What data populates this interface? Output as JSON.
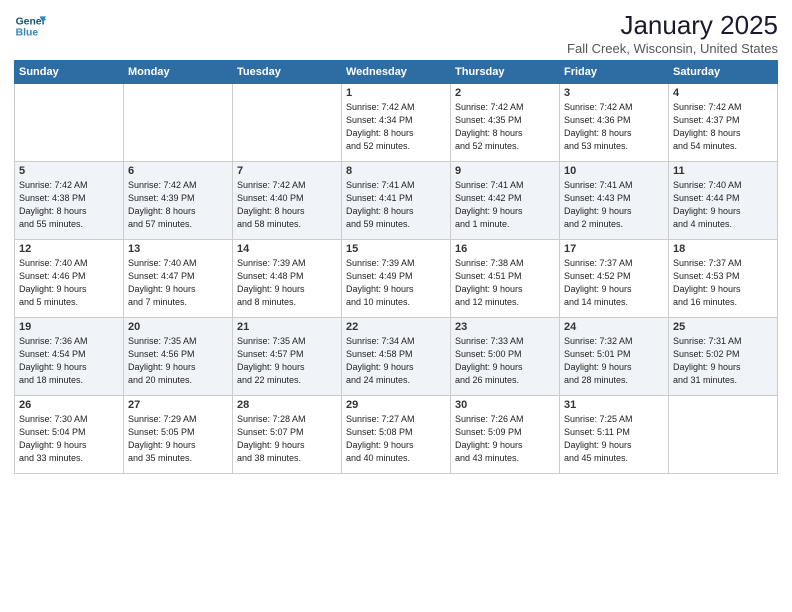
{
  "logo": {
    "line1": "General",
    "line2": "Blue"
  },
  "title": "January 2025",
  "subtitle": "Fall Creek, Wisconsin, United States",
  "days_header": [
    "Sunday",
    "Monday",
    "Tuesday",
    "Wednesday",
    "Thursday",
    "Friday",
    "Saturday"
  ],
  "weeks": [
    [
      {
        "num": "",
        "info": ""
      },
      {
        "num": "",
        "info": ""
      },
      {
        "num": "",
        "info": ""
      },
      {
        "num": "1",
        "info": "Sunrise: 7:42 AM\nSunset: 4:34 PM\nDaylight: 8 hours\nand 52 minutes."
      },
      {
        "num": "2",
        "info": "Sunrise: 7:42 AM\nSunset: 4:35 PM\nDaylight: 8 hours\nand 52 minutes."
      },
      {
        "num": "3",
        "info": "Sunrise: 7:42 AM\nSunset: 4:36 PM\nDaylight: 8 hours\nand 53 minutes."
      },
      {
        "num": "4",
        "info": "Sunrise: 7:42 AM\nSunset: 4:37 PM\nDaylight: 8 hours\nand 54 minutes."
      }
    ],
    [
      {
        "num": "5",
        "info": "Sunrise: 7:42 AM\nSunset: 4:38 PM\nDaylight: 8 hours\nand 55 minutes."
      },
      {
        "num": "6",
        "info": "Sunrise: 7:42 AM\nSunset: 4:39 PM\nDaylight: 8 hours\nand 57 minutes."
      },
      {
        "num": "7",
        "info": "Sunrise: 7:42 AM\nSunset: 4:40 PM\nDaylight: 8 hours\nand 58 minutes."
      },
      {
        "num": "8",
        "info": "Sunrise: 7:41 AM\nSunset: 4:41 PM\nDaylight: 8 hours\nand 59 minutes."
      },
      {
        "num": "9",
        "info": "Sunrise: 7:41 AM\nSunset: 4:42 PM\nDaylight: 9 hours\nand 1 minute."
      },
      {
        "num": "10",
        "info": "Sunrise: 7:41 AM\nSunset: 4:43 PM\nDaylight: 9 hours\nand 2 minutes."
      },
      {
        "num": "11",
        "info": "Sunrise: 7:40 AM\nSunset: 4:44 PM\nDaylight: 9 hours\nand 4 minutes."
      }
    ],
    [
      {
        "num": "12",
        "info": "Sunrise: 7:40 AM\nSunset: 4:46 PM\nDaylight: 9 hours\nand 5 minutes."
      },
      {
        "num": "13",
        "info": "Sunrise: 7:40 AM\nSunset: 4:47 PM\nDaylight: 9 hours\nand 7 minutes."
      },
      {
        "num": "14",
        "info": "Sunrise: 7:39 AM\nSunset: 4:48 PM\nDaylight: 9 hours\nand 8 minutes."
      },
      {
        "num": "15",
        "info": "Sunrise: 7:39 AM\nSunset: 4:49 PM\nDaylight: 9 hours\nand 10 minutes."
      },
      {
        "num": "16",
        "info": "Sunrise: 7:38 AM\nSunset: 4:51 PM\nDaylight: 9 hours\nand 12 minutes."
      },
      {
        "num": "17",
        "info": "Sunrise: 7:37 AM\nSunset: 4:52 PM\nDaylight: 9 hours\nand 14 minutes."
      },
      {
        "num": "18",
        "info": "Sunrise: 7:37 AM\nSunset: 4:53 PM\nDaylight: 9 hours\nand 16 minutes."
      }
    ],
    [
      {
        "num": "19",
        "info": "Sunrise: 7:36 AM\nSunset: 4:54 PM\nDaylight: 9 hours\nand 18 minutes."
      },
      {
        "num": "20",
        "info": "Sunrise: 7:35 AM\nSunset: 4:56 PM\nDaylight: 9 hours\nand 20 minutes."
      },
      {
        "num": "21",
        "info": "Sunrise: 7:35 AM\nSunset: 4:57 PM\nDaylight: 9 hours\nand 22 minutes."
      },
      {
        "num": "22",
        "info": "Sunrise: 7:34 AM\nSunset: 4:58 PM\nDaylight: 9 hours\nand 24 minutes."
      },
      {
        "num": "23",
        "info": "Sunrise: 7:33 AM\nSunset: 5:00 PM\nDaylight: 9 hours\nand 26 minutes."
      },
      {
        "num": "24",
        "info": "Sunrise: 7:32 AM\nSunset: 5:01 PM\nDaylight: 9 hours\nand 28 minutes."
      },
      {
        "num": "25",
        "info": "Sunrise: 7:31 AM\nSunset: 5:02 PM\nDaylight: 9 hours\nand 31 minutes."
      }
    ],
    [
      {
        "num": "26",
        "info": "Sunrise: 7:30 AM\nSunset: 5:04 PM\nDaylight: 9 hours\nand 33 minutes."
      },
      {
        "num": "27",
        "info": "Sunrise: 7:29 AM\nSunset: 5:05 PM\nDaylight: 9 hours\nand 35 minutes."
      },
      {
        "num": "28",
        "info": "Sunrise: 7:28 AM\nSunset: 5:07 PM\nDaylight: 9 hours\nand 38 minutes."
      },
      {
        "num": "29",
        "info": "Sunrise: 7:27 AM\nSunset: 5:08 PM\nDaylight: 9 hours\nand 40 minutes."
      },
      {
        "num": "30",
        "info": "Sunrise: 7:26 AM\nSunset: 5:09 PM\nDaylight: 9 hours\nand 43 minutes."
      },
      {
        "num": "31",
        "info": "Sunrise: 7:25 AM\nSunset: 5:11 PM\nDaylight: 9 hours\nand 45 minutes."
      },
      {
        "num": "",
        "info": ""
      }
    ]
  ]
}
